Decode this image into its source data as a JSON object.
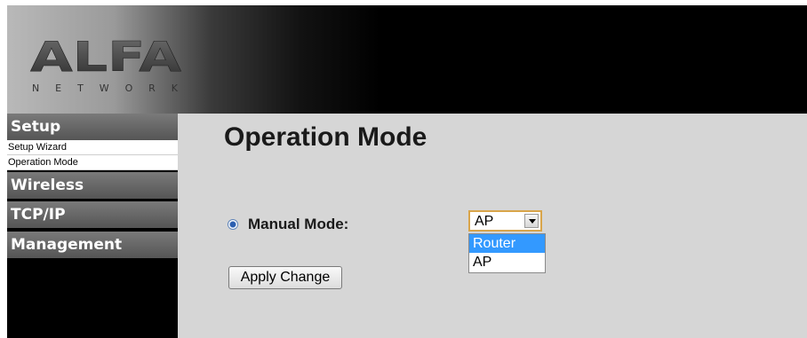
{
  "logo": {
    "brand": "ALFA",
    "tagline": "NETWORK"
  },
  "sidebar": {
    "sections": [
      {
        "label": "Setup",
        "items": [
          "Setup Wizard",
          "Operation Mode"
        ]
      },
      {
        "label": "Wireless"
      },
      {
        "label": "TCP/IP"
      },
      {
        "label": "Management"
      }
    ]
  },
  "main": {
    "title": "Operation Mode",
    "mode_label": "Manual Mode:",
    "mode_select": {
      "value": "AP",
      "options": [
        "Router",
        "AP"
      ],
      "highlighted": "Router"
    },
    "apply_label": "Apply Change"
  }
}
